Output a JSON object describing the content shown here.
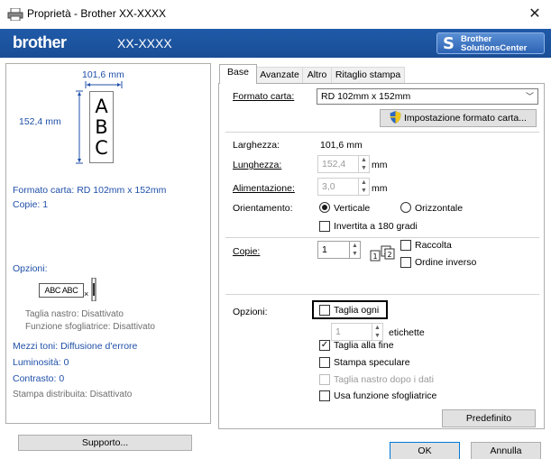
{
  "window": {
    "title": "Proprietà - Brother  XX-XXXX",
    "close_glyph": "✕"
  },
  "header": {
    "brand": "brother",
    "model": "XX-XXXX",
    "solutions_line1": "Brother",
    "solutions_line2": "SolutionsCenter"
  },
  "preview": {
    "width_label": "101,6 mm",
    "height_label": "152,4 mm",
    "letters": [
      "A",
      "B",
      "C"
    ],
    "formato": "Formato carta: RD 102mm x 152mm",
    "copie": "Copie: 1",
    "opzioni_heading": "Opzioni:",
    "tape_sample": "ABC ABC",
    "taglia_nastro": "Taglia nastro: Disattivato",
    "funzione_sfogliatrice": "Funzione sfogliatrice: Disattivato",
    "mezzi_toni": "Mezzi toni: Diffusione d'errore",
    "luminosita": "Luminosità:  0",
    "contrasto": "Contrasto:  0",
    "stampa_distribuita": "Stampa distribuita: Disattivato",
    "supporto_button": "Supporto..."
  },
  "tabs": [
    "Base",
    "Avanzate",
    "Altro",
    "Ritaglio stampa"
  ],
  "base": {
    "formato_label": "Formato carta:",
    "formato_value": "RD 102mm x 152mm",
    "impostazione_button": "Impostazione formato carta...",
    "larghezza_label": "Larghezza:",
    "larghezza_value": "101,6 mm",
    "lunghezza_label": "Lunghezza:",
    "lunghezza_value": "152,4",
    "lunghezza_unit": "mm",
    "alimentazione_label": "Alimentazione:",
    "alimentazione_value": "3,0",
    "alimentazione_unit": "mm",
    "orientamento_label": "Orientamento:",
    "verticale": "Verticale",
    "orizzontale": "Orizzontale",
    "invertita": "Invertita a 180 gradi",
    "copie_label": "Copie:",
    "copie_value": "1",
    "raccolta": "Raccolta",
    "ordine_inverso": "Ordine inverso",
    "opzioni_label": "Opzioni:",
    "taglia_ogni": "Taglia ogni",
    "etichette_value": "1",
    "etichette": "etichette",
    "taglia_alla_fine": "Taglia alla fine",
    "stampa_speculare": "Stampa speculare",
    "taglia_nastro_dopo": "Taglia nastro dopo i dati",
    "usa_funzione": "Usa funzione sfogliatrice",
    "predefinito_button": "Predefinito"
  },
  "footer": {
    "ok": "OK",
    "annulla": "Annulla"
  },
  "colors": {
    "banner": "#1f5aa8",
    "link_text": "#1f4fa8"
  },
  "icons": {
    "app": "printer-icon",
    "shield": "uac-shield-icon",
    "solutions": "brother-s-logo-icon"
  }
}
